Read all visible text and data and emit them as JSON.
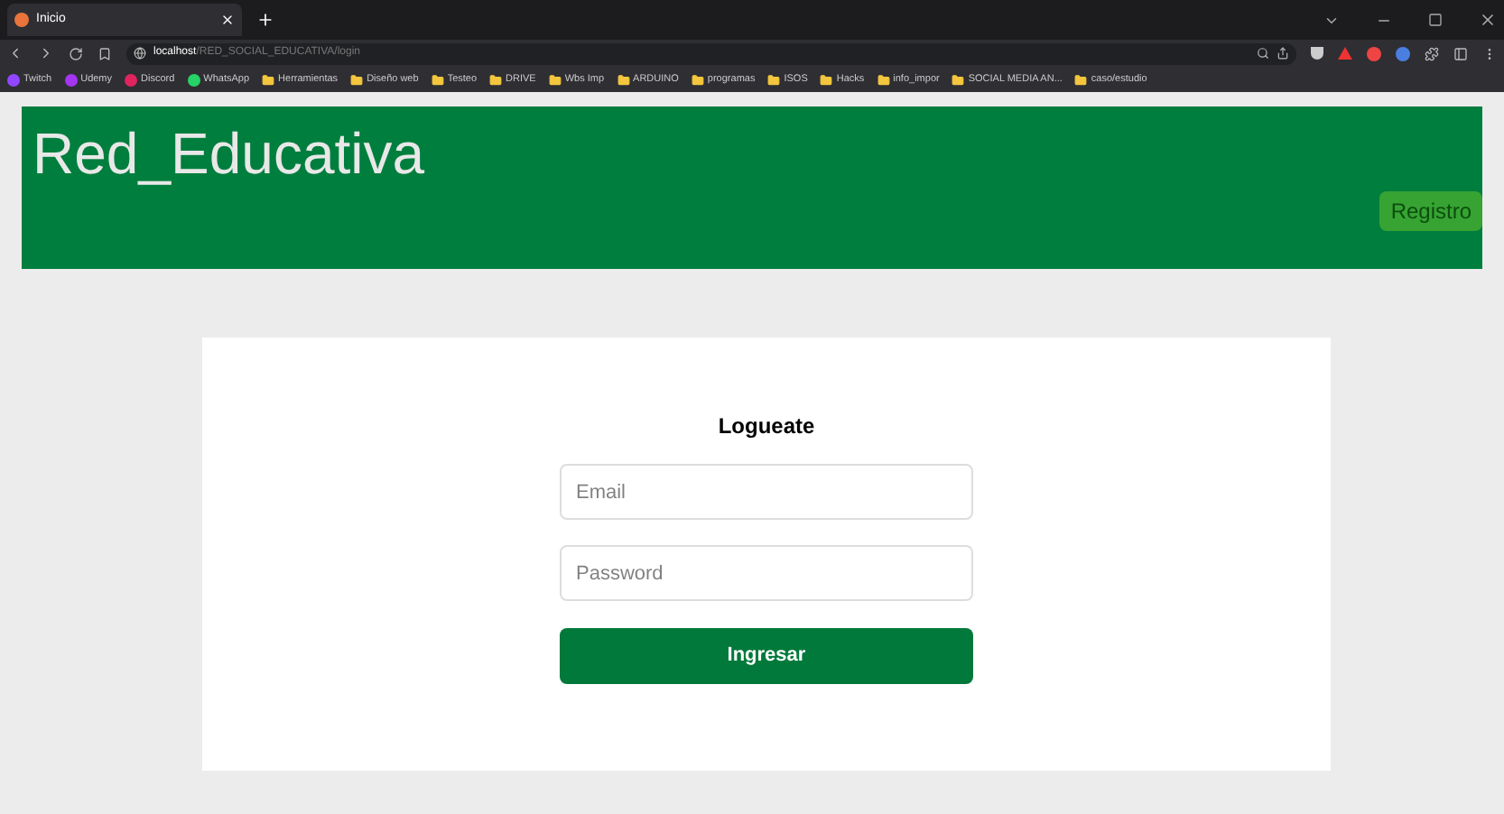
{
  "browser": {
    "tab_title": "Inicio",
    "url_host": "localhost",
    "url_path": "/RED_SOCIAL_EDUCATIVA/login",
    "bookmarks": [
      {
        "kind": "site",
        "label": "Twitch",
        "color": "#9146ff"
      },
      {
        "kind": "site",
        "label": "Udemy",
        "color": "#a435f0"
      },
      {
        "kind": "site",
        "label": "Discord",
        "color": "#e0245e"
      },
      {
        "kind": "site",
        "label": "WhatsApp",
        "color": "#25d366"
      },
      {
        "kind": "folder",
        "label": "Herramientas"
      },
      {
        "kind": "folder",
        "label": "Diseño web"
      },
      {
        "kind": "folder",
        "label": "Testeo"
      },
      {
        "kind": "folder",
        "label": "DRIVE"
      },
      {
        "kind": "folder",
        "label": "Wbs Imp"
      },
      {
        "kind": "folder",
        "label": "ARDUINO"
      },
      {
        "kind": "folder",
        "label": "programas"
      },
      {
        "kind": "folder",
        "label": "ISOS"
      },
      {
        "kind": "folder",
        "label": "Hacks"
      },
      {
        "kind": "folder",
        "label": "info_impor"
      },
      {
        "kind": "folder",
        "label": "SOCIAL MEDIA AN..."
      },
      {
        "kind": "folder",
        "label": "caso/estudio"
      }
    ]
  },
  "header": {
    "brand": "Red_Educativa",
    "register_button": "Registro"
  },
  "login": {
    "title": "Logueate",
    "email": {
      "placeholder": "Email"
    },
    "password": {
      "placeholder": "Password"
    },
    "submit": "Ingresar"
  }
}
